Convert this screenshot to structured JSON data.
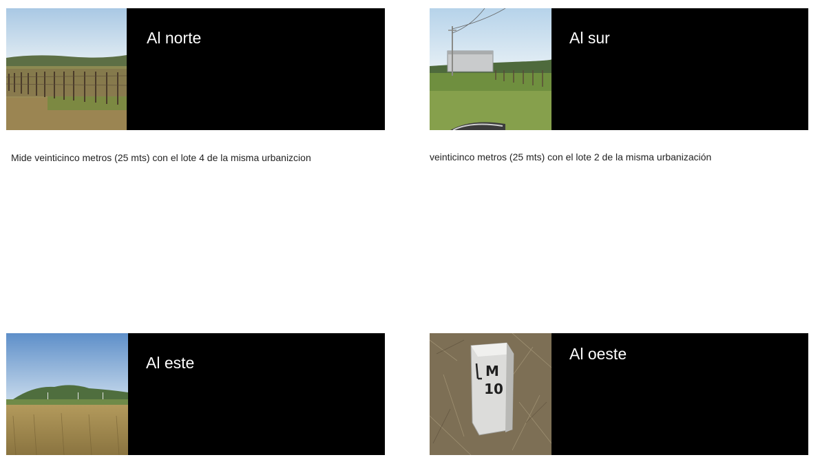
{
  "sections": {
    "north": {
      "title": "Al norte",
      "description": "Mide veinticinco metros (25 mts) con el lote 4 de la misma urbanizcion"
    },
    "south": {
      "title": "Al sur",
      "description": "veinticinco metros (25 mts) con el lote 2 de la misma urbanización"
    },
    "east": {
      "title": "Al este"
    },
    "west": {
      "title": "Al oeste",
      "marker_text": "M 10",
      "marker_side_letter": "L"
    }
  },
  "colors": {
    "card_background": "#000000",
    "title_text": "#ffffff",
    "description_text": "#222222",
    "page_background": "#ffffff"
  }
}
